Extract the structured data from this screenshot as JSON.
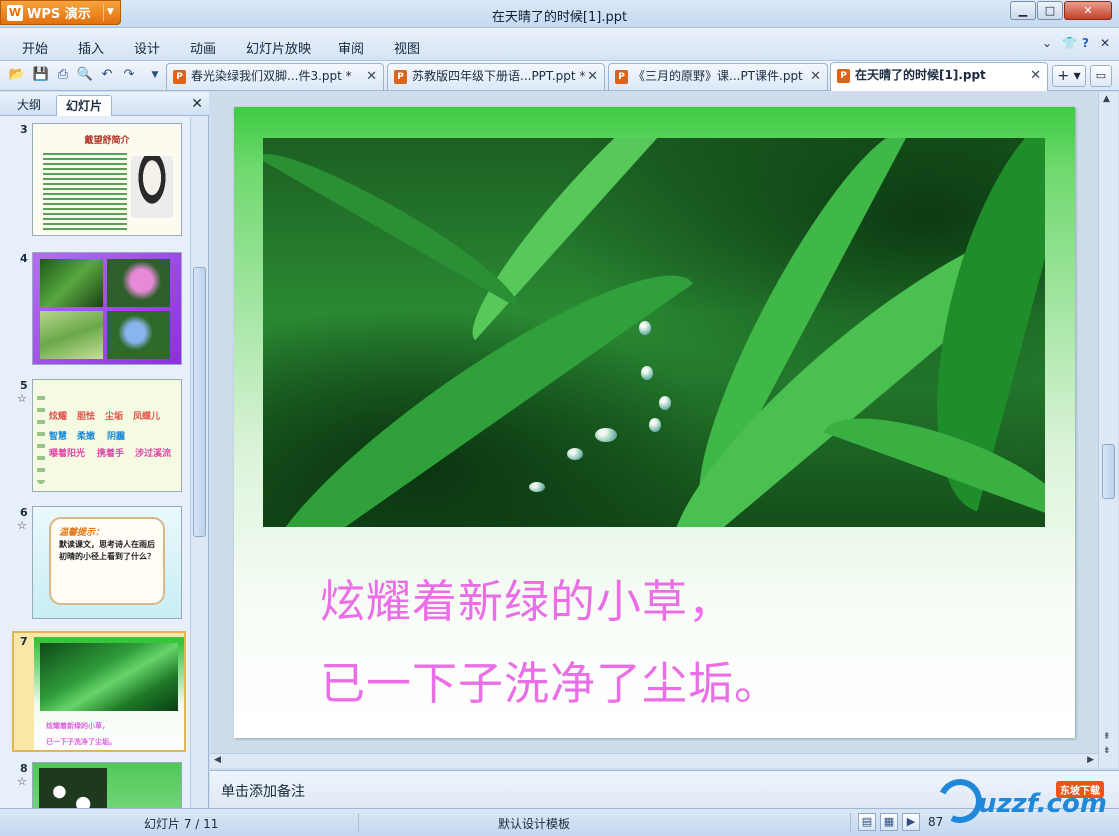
{
  "app": {
    "button_label": "WPS 演示",
    "logo_letter": "W",
    "window_title": "在天晴了的时候[1].ppt"
  },
  "menu": [
    "开始",
    "插入",
    "设计",
    "动画",
    "幻灯片放映",
    "审阅",
    "视图"
  ],
  "tabs": [
    {
      "label": "春光染绿我们双脚...件3.ppt *"
    },
    {
      "label": "苏教版四年级下册语...PPT.ppt *"
    },
    {
      "label": "《三月的原野》课...PT课件.ppt"
    },
    {
      "label": "在天晴了的时候[1].ppt"
    }
  ],
  "left_pane": {
    "tab_outline": "大纲",
    "tab_slides": "幻灯片"
  },
  "thumbnails": {
    "s3": {
      "num": "3",
      "title": "戴望舒简介"
    },
    "s4": {
      "num": "4"
    },
    "s5": {
      "num": "5",
      "star": "☆",
      "words": [
        "炫耀",
        "胆怯",
        "尘垢",
        "凤蝶儿",
        "智慧",
        "柔嫩",
        "阴霾",
        "曝着阳光",
        "携着手",
        "涉过溪流"
      ]
    },
    "s6": {
      "num": "6",
      "star": "☆",
      "heading": "温馨提示：",
      "body": "默读课文，思考诗人在雨后初晴的小径上看到了什么？"
    },
    "s7": {
      "num": "7",
      "line1": "炫耀着新绿的小草，",
      "line2": "已一下子洗净了尘垢。"
    },
    "s8": {
      "num": "8",
      "star": "☆"
    }
  },
  "slide": {
    "line1": "炫耀着新绿的小草，",
    "line2": "已一下子洗净了尘垢。"
  },
  "notes_placeholder": "单击添加备注",
  "status": {
    "slide_position": "幻灯片 7 / 11",
    "template": "默认设计模板",
    "zoom": "87"
  },
  "watermark": {
    "text": "uzzf.com",
    "badge": "东坡下载"
  }
}
